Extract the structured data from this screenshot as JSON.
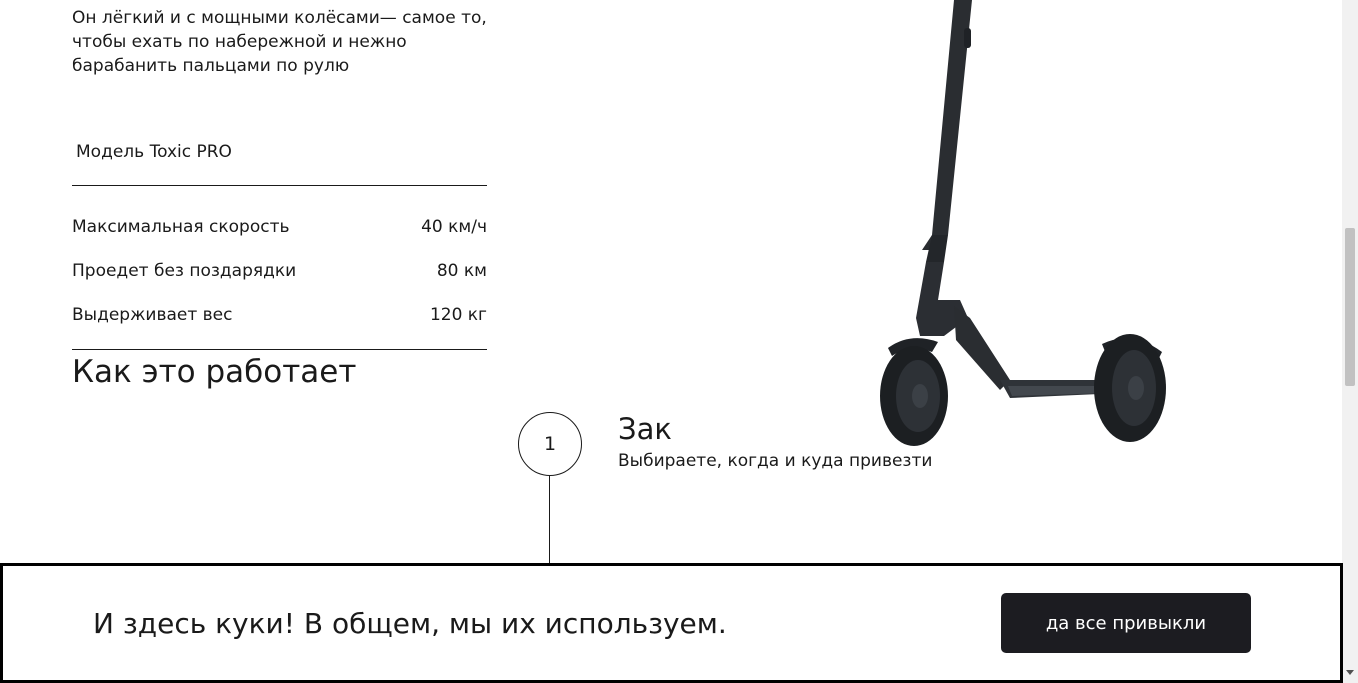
{
  "intro": {
    "text": "Он лёгкий и с мощными колёсами— самое то, чтобы ехать по набережной и нежно барабанить пальцами по рулю"
  },
  "model": {
    "title": "Модель Toxic PRO"
  },
  "specs": [
    {
      "label": "Максимальная скорость",
      "value": "40 км/ч"
    },
    {
      "label": "Проедет без поздарядки",
      "value": "80 км"
    },
    {
      "label": "Выдерживает вес",
      "value": "120 кг"
    }
  ],
  "how_it_works": {
    "title": "Как это работает",
    "steps": [
      {
        "number": "1",
        "title": "Зак",
        "description": "Выбираете, когда и куда привезти"
      }
    ]
  },
  "cookie_banner": {
    "text": "И здесь куки! В общем, мы их используем.",
    "button_label": "да все привыкли"
  },
  "icons": {
    "product_image": "scooter-image"
  },
  "colors": {
    "text": "#1a1a1a",
    "button_bg": "#1c1c21",
    "button_text": "#ffffff",
    "scooter": "#2a2d31"
  }
}
